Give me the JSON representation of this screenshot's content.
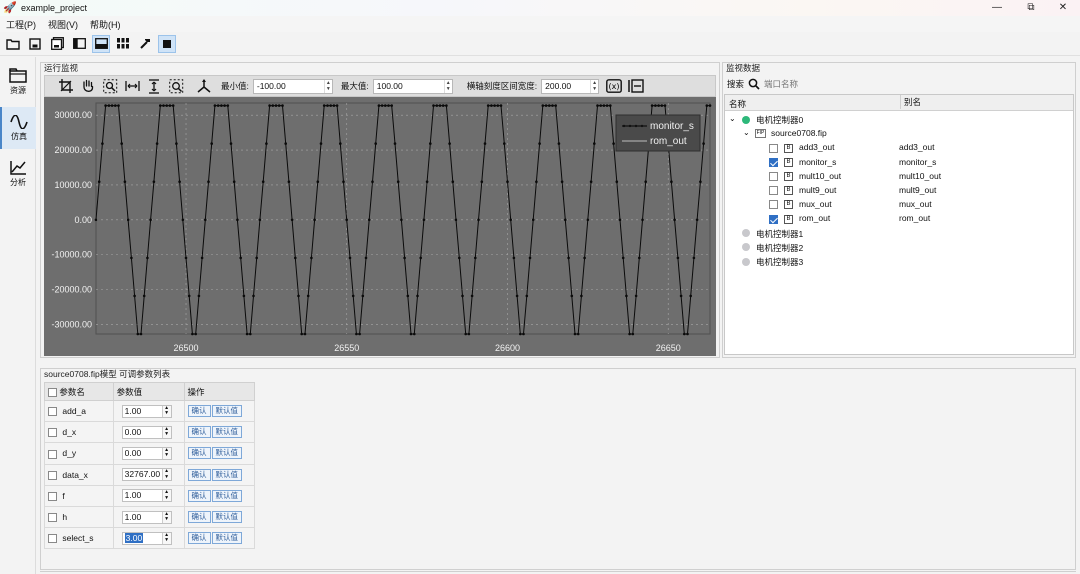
{
  "window": {
    "title": "example_project",
    "minimize": "—",
    "restore": "⧉",
    "close": "✕"
  },
  "menu": [
    "工程(P)",
    "视图(V)",
    "帮助(H)"
  ],
  "sidenav": [
    {
      "label": "资源",
      "icon": "folder-icon"
    },
    {
      "label": "仿真",
      "icon": "wave-icon",
      "active": true
    },
    {
      "label": "分析",
      "icon": "chart-icon"
    }
  ],
  "monitor": {
    "group_title": "运行监视",
    "min_label": "最小值:",
    "min_value": "-100.00",
    "max_label": "最大值:",
    "max_value": "100.00",
    "width_label": "横轴刻度区间宽度:",
    "width_value": "200.00"
  },
  "chart_data": {
    "type": "line",
    "xlim": [
      26472,
      26663
    ],
    "ylim": [
      -32768,
      33500
    ],
    "x_ticks": [
      26500,
      26550,
      26600,
      26650
    ],
    "y_ticks": [
      30000,
      20000,
      10000,
      0,
      -10000,
      -20000,
      -30000
    ],
    "x_tick_labels": [
      "26500",
      "26550",
      "26600",
      "26650"
    ],
    "y_tick_labels": [
      "30000.00",
      "20000.00",
      "10000.00",
      "0.00",
      "-10000.00",
      "-20000.00",
      "-30000.00"
    ],
    "legend_position": "top-right",
    "series": [
      {
        "name": "monitor_s",
        "style": "line with dots",
        "period": 17,
        "peak": 32767,
        "trough": -32768
      },
      {
        "name": "rom_out",
        "style": "line"
      }
    ]
  },
  "data_panel": {
    "group_title": "监视数据",
    "search_label": "搜索",
    "search_placeholder": "端口名称",
    "col_name": "名称",
    "col_alias": "别名",
    "controllers": [
      {
        "name": "电机控制器0",
        "color": "#2db87a",
        "expanded": true
      },
      {
        "name": "电机控制器1",
        "color": "#c8c8cc"
      },
      {
        "name": "电机控制器2",
        "color": "#c8c8cc"
      },
      {
        "name": "电机控制器3",
        "color": "#c8c8cc"
      }
    ],
    "file": "source0708.fip",
    "file_icon": "FIP",
    "signals": [
      {
        "name": "add3_out",
        "alias": "add3_out",
        "checked": false
      },
      {
        "name": "monitor_s",
        "alias": "monitor_s",
        "checked": true
      },
      {
        "name": "mult10_out",
        "alias": "mult10_out",
        "checked": false
      },
      {
        "name": "mult9_out",
        "alias": "mult9_out",
        "checked": false
      },
      {
        "name": "mux_out",
        "alias": "mux_out",
        "checked": false
      },
      {
        "name": "rom_out",
        "alias": "rom_out",
        "checked": true
      }
    ]
  },
  "params": {
    "group_title": "source0708.fip模型 可调参数列表",
    "col_name": "参数名",
    "col_value": "参数值",
    "col_op": "操作",
    "confirm": "确认",
    "default": "默认值",
    "rows": [
      {
        "name": "add_a",
        "value": "1.00"
      },
      {
        "name": "d_x",
        "value": "0.00"
      },
      {
        "name": "d_y",
        "value": "0.00"
      },
      {
        "name": "data_x",
        "value": "32767.00"
      },
      {
        "name": "f",
        "value": "1.00"
      },
      {
        "name": "h",
        "value": "1.00"
      },
      {
        "name": "select_s",
        "value": "3.00",
        "selected": true
      }
    ]
  }
}
